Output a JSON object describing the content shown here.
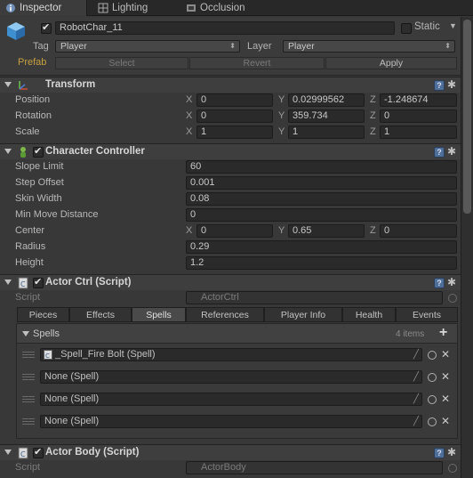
{
  "tabs": [
    {
      "label": "Inspector",
      "icon": "info-icon"
    },
    {
      "label": "Lighting",
      "icon": "lighting-icon"
    },
    {
      "label": "Occlusion",
      "icon": "occlusion-icon"
    }
  ],
  "object": {
    "name": "RobotChar_11",
    "active": true,
    "static_label": "Static",
    "tag_label": "Tag",
    "tag_value": "Player",
    "layer_label": "Layer",
    "layer_value": "Player",
    "prefab_label": "Prefab",
    "prefab_buttons": [
      "Select",
      "Revert",
      "Apply"
    ]
  },
  "transform": {
    "title": "Transform",
    "rows": [
      {
        "label": "Position",
        "x": "0",
        "y": "0.02999562",
        "z": "-1.248674"
      },
      {
        "label": "Rotation",
        "x": "0",
        "y": "359.734",
        "z": "0"
      },
      {
        "label": "Scale",
        "x": "1",
        "y": "1",
        "z": "1"
      }
    ],
    "axes": [
      "X",
      "Y",
      "Z"
    ]
  },
  "character_controller": {
    "title": "Character Controller",
    "enabled": true,
    "rows": [
      {
        "label": "Slope Limit",
        "value": "60"
      },
      {
        "label": "Step Offset",
        "value": "0.001"
      },
      {
        "label": "Skin Width",
        "value": "0.08"
      },
      {
        "label": "Min Move Distance",
        "value": "0"
      }
    ],
    "center": {
      "label": "Center",
      "x": "0",
      "y": "0.65",
      "z": "0"
    },
    "radius": {
      "label": "Radius",
      "value": "0.29"
    },
    "height": {
      "label": "Height",
      "value": "1.2"
    }
  },
  "actor_ctrl": {
    "title": "Actor Ctrl (Script)",
    "enabled": true,
    "script_label": "Script",
    "script_value": "ActorCtrl",
    "tabs": [
      "Pieces",
      "Effects",
      "Spells",
      "References",
      "Player Info",
      "Health",
      "Events"
    ],
    "active_tab": "Spells",
    "spells_label": "Spells",
    "spells_count": "4 items",
    "items": [
      "_Spell_Fire Bolt (Spell)",
      "None (Spell)",
      "None (Spell)",
      "None (Spell)"
    ]
  },
  "actor_body": {
    "title": "Actor Body (Script)",
    "enabled": true,
    "script_label": "Script",
    "script_value": "ActorBody"
  },
  "colors": {
    "panel": "#383838",
    "field": "#2a2a2a",
    "accent_prefab": "#c8a040",
    "help_blue": "#4d6f9a"
  }
}
